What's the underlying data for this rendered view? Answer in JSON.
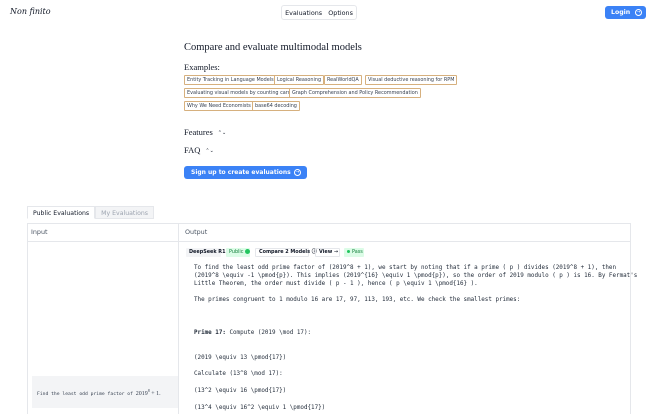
{
  "header": {
    "logo": "Non finito",
    "nav": [
      "Evaluations",
      "Options"
    ],
    "login": "Login"
  },
  "hero": {
    "title": "Compare and evaluate multimodal models",
    "examples_title": "Examples:",
    "examples": [
      "Entity Tracking in Language Models",
      "Logical Reasoning",
      "RealWorldQA",
      "Visual deductive reasoning for RPM",
      "Evaluating visual models by counting cards",
      "Graph Comprehension and Policy Recommendation",
      "Why We Need Economists",
      "base64 decoding"
    ],
    "features_label": "Features",
    "faq_label": "FAQ",
    "signup_button": "Sign up to create evaluations"
  },
  "tabs": [
    "Public Evaluations",
    "My Evaluations"
  ],
  "table": {
    "col_input": "Input",
    "col_output": "Output",
    "row": {
      "input_prefix": "Find the least odd prime factor of ",
      "input_math_base": "2019",
      "input_math_exp": "8",
      "input_math_rest": " + 1.",
      "model": "DeepSeek R1",
      "visibility": "Public",
      "compare": "Compare 2 Models",
      "view": "View →",
      "status": "Pass",
      "output_lines": [
        "To find the least odd prime factor of (2019^8 + 1), we start by noting that if a prime ( p ) divides (2019^8 + 1), then",
        "(2019^8 \\equiv -1 \\pmod{p}). This implies (2019^{16} \\equiv 1 \\pmod{p}), so the order of 2019 modulo ( p ) is 16. By Fermat's",
        "Little Theorem, the order must divide ( p - 1 ), hence ( p \\equiv 1 \\pmod{16} ).",
        "The primes congruent to 1 modulo 16 are 17, 97, 113, 193, etc. We check the smallest primes:",
        "Prime 17:",
        " Compute (2019 \\mod 17):",
        "(2019 \\equiv 13 \\pmod{17})",
        "Calculate (13^8 \\mod 17):",
        "(13^2 \\equiv 16 \\pmod{17})",
        "(13^4 \\equiv 16^2 \\equiv 1 \\pmod{17})"
      ]
    }
  },
  "colors": {
    "accent": "#3b82f6",
    "chip_border": "#d6b07e",
    "pass_green": "#22c55e"
  }
}
